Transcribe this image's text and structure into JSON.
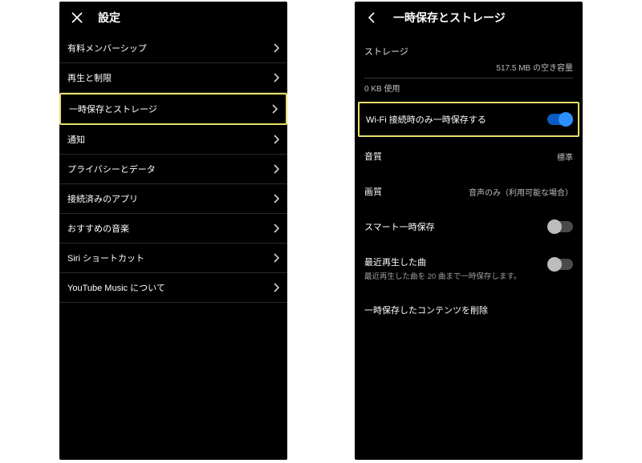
{
  "left": {
    "title": "設定",
    "items": [
      "有料メンバーシップ",
      "再生と制限",
      "一時保存とストレージ",
      "通知",
      "プライバシーとデータ",
      "接続済みのアプリ",
      "おすすめの音楽",
      "Siri ショートカット",
      "YouTube Music について"
    ],
    "highlight_index": 2
  },
  "right": {
    "title": "一時保存とストレージ",
    "storage_label": "ストレージ",
    "storage_free": "517.5 MB の空き容量",
    "storage_used": "0 KB 使用",
    "wifi_only": {
      "label": "Wi-Fi 接続時のみ一時保存する",
      "on": true
    },
    "audio_quality": {
      "label": "音質",
      "value": "標準"
    },
    "video_quality": {
      "label": "画質",
      "value": "音声のみ（利用可能な場合）"
    },
    "smart_download": {
      "label": "スマート一時保存",
      "on": false
    },
    "recent": {
      "label": "最近再生した曲",
      "desc": "最近再生した曲を 20 曲まで一時保存します。",
      "on": false
    },
    "delete_label": "一時保存したコンテンツを削除"
  }
}
